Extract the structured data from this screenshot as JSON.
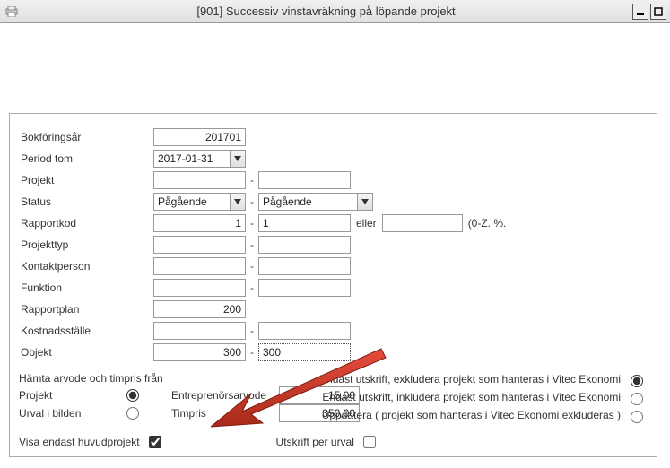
{
  "window": {
    "title": "[901]  Successiv vinstavräkning på löpande projekt"
  },
  "fields": {
    "bokforingsar": {
      "label": "Bokföringsår",
      "value": "201701"
    },
    "period_tom": {
      "label": "Period tom",
      "value": "2017-01-31"
    },
    "projekt": {
      "label": "Projekt",
      "from": "",
      "to": ""
    },
    "status": {
      "label": "Status",
      "from": "Pågående",
      "to": "Pågående"
    },
    "rapportkod": {
      "label": "Rapportkod",
      "from": "1",
      "to": "1",
      "eller_label": "eller",
      "eller_value": "",
      "hint": "(0-Z. %."
    },
    "projekttyp": {
      "label": "Projekttyp",
      "from": "",
      "to": ""
    },
    "kontaktperson": {
      "label": "Kontaktperson",
      "from": "",
      "to": ""
    },
    "funktion": {
      "label": "Funktion",
      "from": "",
      "to": ""
    },
    "rapportplan": {
      "label": "Rapportplan",
      "value": "200"
    },
    "kostnadsstalle": {
      "label": "Kostnadsställe",
      "from": "",
      "to": ""
    },
    "objekt": {
      "label": "Objekt",
      "from": "300",
      "to": "300"
    }
  },
  "hamta": {
    "title": "Hämta arvode och timpris från",
    "options": {
      "projekt": "Projekt",
      "urval": "Urval i bilden"
    },
    "entreprenorsarvode": {
      "label": "Entreprenörsarvode",
      "value": "15,00"
    },
    "timpris": {
      "label": "Timpris",
      "value": "350,00"
    }
  },
  "right_options": {
    "opt1": "Endast utskrift, exkludera projekt som hanteras i Vitec Ekonomi",
    "opt2": "Endast utskrift, inkludera projekt som hanteras i Vitec Ekonomi",
    "opt3": "Uppdatera ( projekt som hanteras i Vitec Ekonomi exkluderas )"
  },
  "visa_huvudprojekt": {
    "label": "Visa endast huvudprojekt"
  },
  "utskrift_per_urval": {
    "label": "Utskrift per urval"
  }
}
